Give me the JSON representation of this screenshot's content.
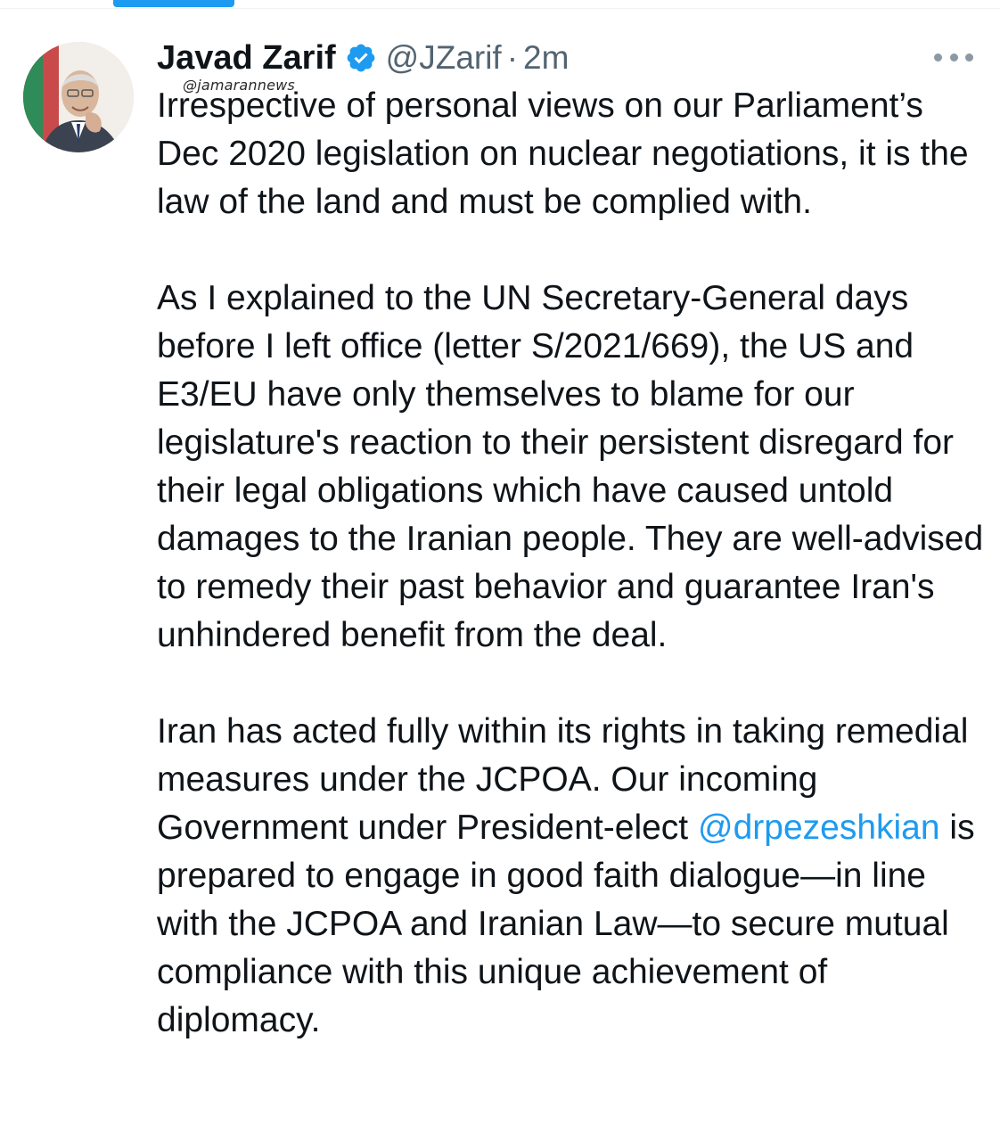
{
  "header": {
    "display_name": "Javad Zarif",
    "handle": "@JZarif",
    "separator": "·",
    "timestamp": "2m"
  },
  "watermark": "@jamarannews",
  "tweet": {
    "paragraph_1": "Irrespective of personal views on our Parliament’s Dec 2020 legislation on nuclear negotiations, it is the law of the land and must be complied with.",
    "paragraph_2": "As I explained to the UN Secretary-General days before I left office (letter S/2021/669), the US and E3/EU have only themselves to blame for our legislature's reaction to their persistent disregard for their legal obligations which have caused untold damages to the Iranian people. They are well-advised to remedy their past behavior and guarantee Iran's unhindered benefit from the deal.",
    "paragraph_3_start": "Iran has acted fully within its rights in taking remedial measures under the JCPOA. Our incoming Government under President-elect ",
    "mention": "@drpezeshkian",
    "paragraph_3_end": " is prepared to engage in good faith dialogue—in line with the JCPOA and Iranian Law—to secure mutual compliance with this unique achievement of diplomacy."
  },
  "icons": {
    "verified": "verified-badge-icon",
    "more": "more-options-icon"
  },
  "colors": {
    "accent": "#1d9bf0",
    "text": "#0f1419",
    "secondary": "#536471"
  }
}
